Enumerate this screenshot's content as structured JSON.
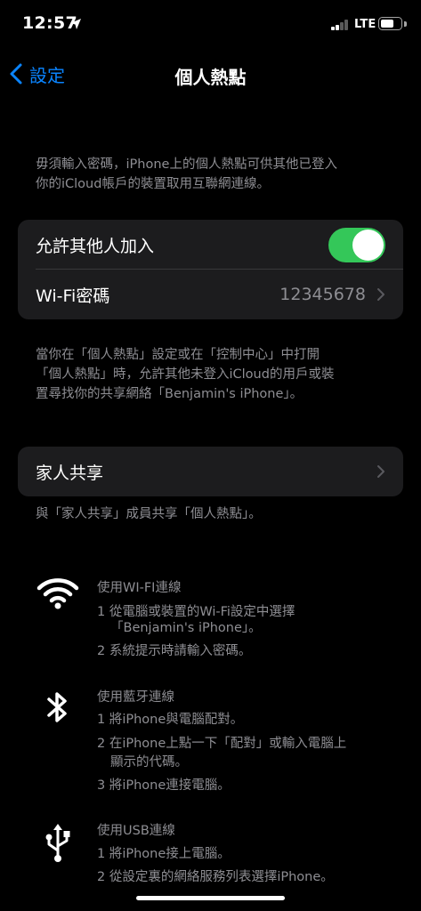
{
  "status_bar": {
    "time": "12:57",
    "network": "LTE",
    "location_icon": "location-arrow-icon",
    "signal_icon": "cellular-signal-icon",
    "battery_icon": "battery-icon"
  },
  "nav": {
    "back_label": "設定",
    "title": "個人熱點"
  },
  "intro": {
    "lines": [
      "毋須輸入密碼，iPhone上的個人熱點可供其他已登入",
      "你的iCloud帳戶的裝置取用互聯網連線。"
    ]
  },
  "hotspot_group": {
    "allow_others_label": "允許其他人加入",
    "allow_others_on": true,
    "wifi_password_label": "Wi-Fi密碼",
    "wifi_password_value": "12345678"
  },
  "hotspot_note": {
    "lines": [
      "當你在「個人熱點」設定或在「控制中心」中打開",
      "「個人熱點」時，允許其他未登入iCloud的用戶或裝",
      "置尋找你的共享網絡「Benjamin's iPhone」。"
    ]
  },
  "family_group": {
    "label": "家人共享"
  },
  "family_note": "與「家人共享」成員共享「個人熱點」。",
  "methods": [
    {
      "icon": "wifi-icon",
      "title": "使用WI-FI連線",
      "lines": [
        "1 從電腦或裝置的Wi-Fi設定中選擇",
        "「Benjamin's iPhone」。",
        "2 系統提示時請輸入密碼。"
      ]
    },
    {
      "icon": "bluetooth-icon",
      "title": "使用藍牙連線",
      "lines": [
        "1 將iPhone與電腦配對。",
        "2 在iPhone上點一下「配對」或輸入電腦上",
        "顯示的代碼。",
        "3 將iPhone連接電腦。"
      ]
    },
    {
      "icon": "usb-icon",
      "title": "使用USB連線",
      "lines": [
        "1 將iPhone接上電腦。",
        "2 從設定裏的網絡服務列表選擇iPhone。"
      ]
    }
  ],
  "colors": {
    "background": "#000000",
    "cell": "#1c1c1e",
    "accent_blue": "#0a84ff",
    "toggle_green": "#34c759",
    "secondary_text": "#8e8e93"
  }
}
